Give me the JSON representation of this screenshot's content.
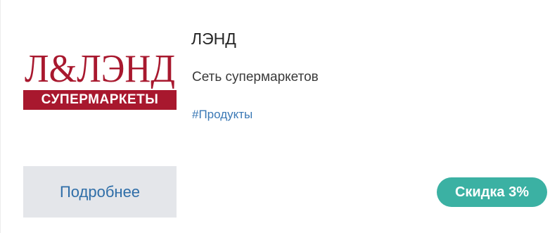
{
  "company": {
    "name": "ЛЭНД",
    "description": "Сеть супермаркетов",
    "tag": "#Продукты"
  },
  "logo": {
    "wordmark": "Л&ЛЭНД",
    "subtitle": "СУПЕРМАРКЕТЫ",
    "brand_color": "#a8182e"
  },
  "actions": {
    "details_label": "Подробнее"
  },
  "badge": {
    "discount_label": "Скидка 3%",
    "color": "#3bb1a3"
  }
}
